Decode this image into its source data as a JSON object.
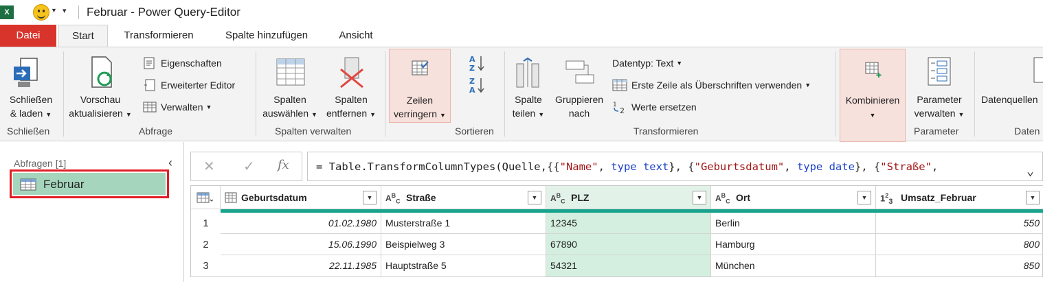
{
  "titlebar": {
    "app_icon": "X",
    "window_title": "Februar - Power Query-Editor"
  },
  "tabs": [
    {
      "label": "Datei"
    },
    {
      "label": "Start"
    },
    {
      "label": "Transformieren"
    },
    {
      "label": "Spalte hinzufügen"
    },
    {
      "label": "Ansicht"
    }
  ],
  "ribbon": {
    "close_load": {
      "line1": "Schließen",
      "line2": "& laden"
    },
    "group_close": "Schließen",
    "refresh": {
      "line1": "Vorschau",
      "line2": "aktualisieren"
    },
    "properties": "Eigenschaften",
    "advanced_editor": "Erweiterter Editor",
    "manage": "Verwalten",
    "group_query": "Abfrage",
    "choose_columns": {
      "line1": "Spalten",
      "line2": "auswählen"
    },
    "remove_columns": {
      "line1": "Spalten",
      "line2": "entfernen"
    },
    "group_manage_columns": "Spalten verwalten",
    "reduce_rows": {
      "line1": "Zeilen",
      "line2": "verringern"
    },
    "group_sort": "Sortieren",
    "split_column": {
      "line1": "Spalte",
      "line2": "teilen"
    },
    "group_by": {
      "line1": "Gruppieren",
      "line2": "nach"
    },
    "data_type": "Datentyp: Text",
    "first_row_headers": "Erste Zeile als Überschriften verwenden",
    "replace_values": "Werte ersetzen",
    "group_transform": "Transformieren",
    "combine": {
      "line1": "Kombinieren"
    },
    "parameters": {
      "line1": "Parameter",
      "line2": "verwalten"
    },
    "group_parameters": "Parameter",
    "data_sources": {
      "line1": "Datenquellen"
    },
    "group_data_sources": "Daten"
  },
  "leftpane": {
    "queries_label": "Abfragen [1]",
    "query_name": "Februar"
  },
  "formula": {
    "prefix": "= Table.TransformColumnTypes(Quelle,{{",
    "s1": "\"Name\"",
    "sep1": ", ",
    "k1": "type text",
    "mid1": "}, {",
    "s2": "\"Geburtsdatum\"",
    "sep2": ", ",
    "k2": "type date",
    "mid2": "}, {",
    "s3": "\"Straße\"",
    "tail": ","
  },
  "grid": {
    "columns": [
      {
        "name": "Geburtsdatum",
        "type_icon": "calendar-icon"
      },
      {
        "name": "Straße",
        "type_icon": "ABC"
      },
      {
        "name": "PLZ",
        "type_icon": "ABC"
      },
      {
        "name": "Ort",
        "type_icon": "ABC"
      },
      {
        "name": "Umsatz_Februar",
        "type_icon": "123"
      }
    ],
    "rows": [
      {
        "num": "1",
        "cells": [
          "01.02.1980",
          "Musterstraße 1",
          "12345",
          "Berlin",
          "550"
        ]
      },
      {
        "num": "2",
        "cells": [
          "15.06.1990",
          "Beispielweg 3",
          "67890",
          "Hamburg",
          "800"
        ]
      },
      {
        "num": "3",
        "cells": [
          "22.11.1985",
          "Hauptstraße 5",
          "54321",
          "München",
          "850"
        ]
      }
    ]
  },
  "colors": {
    "file_tab": "#d9342b",
    "selected_query": "#a5d6bd",
    "highlight_border": "#e21c24",
    "quality_bar": "#17a38c"
  }
}
